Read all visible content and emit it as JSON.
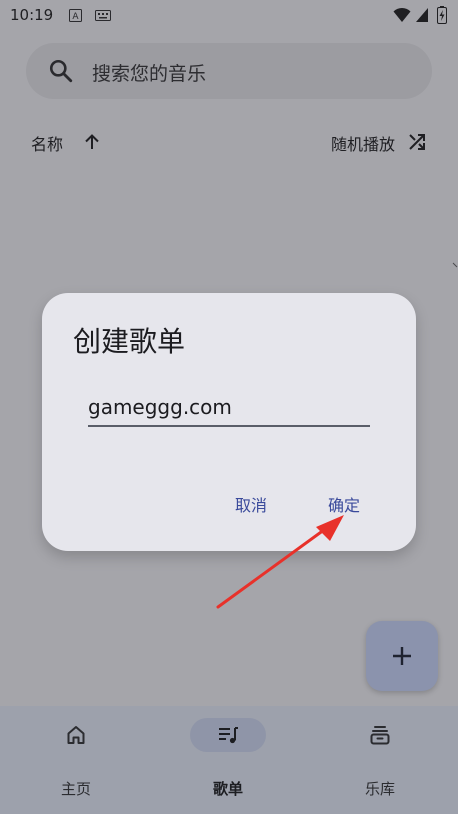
{
  "status_bar": {
    "time": "10:19"
  },
  "search": {
    "placeholder": "搜索您的音乐"
  },
  "sort": {
    "label": "名称",
    "shuffle_label": "随机播放"
  },
  "dialog": {
    "title": "创建歌单",
    "input_value": "gameggg.com",
    "cancel_label": "取消",
    "confirm_label": "确定"
  },
  "annotation": {
    "arrow_color": "#e8312a"
  },
  "fab": {
    "icon": "plus-icon"
  },
  "nav": {
    "items": [
      {
        "label": "主页",
        "icon": "home-icon",
        "active": false
      },
      {
        "label": "歌单",
        "icon": "playlist-icon",
        "active": true
      },
      {
        "label": "乐库",
        "icon": "library-icon",
        "active": false
      }
    ]
  },
  "colors": {
    "accent": "#3a4a9b",
    "dialog_bg": "#e6e6ec",
    "scrim_bg": "#a5a5aa",
    "nav_bg": "#9da1ac"
  }
}
